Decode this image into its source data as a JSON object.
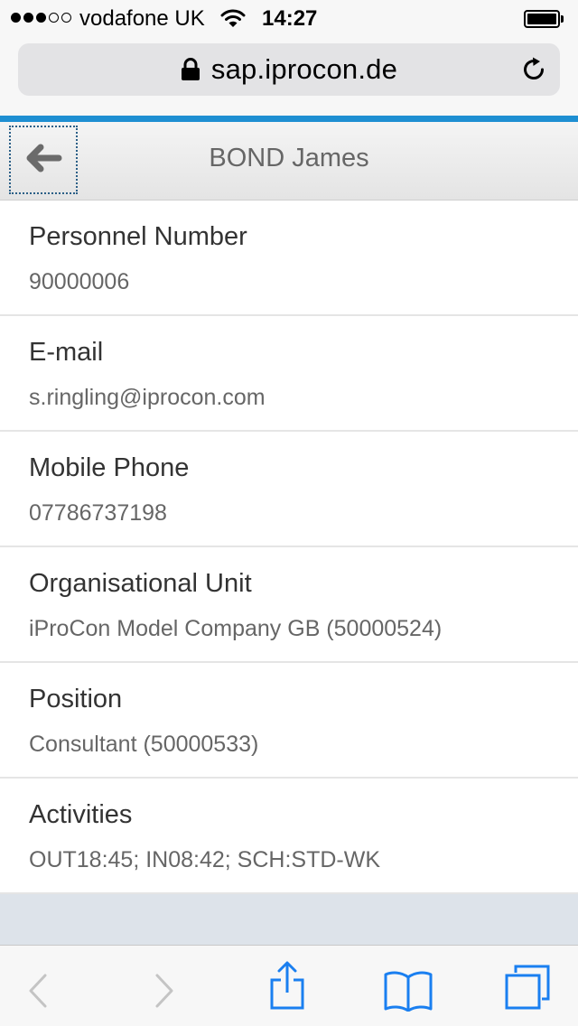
{
  "status_bar": {
    "signal_bars_filled": 3,
    "signal_bars_total": 5,
    "carrier": "vodafone UK",
    "time": "14:27",
    "battery_level": 1.0
  },
  "browser": {
    "url": "sap.iprocon.de",
    "icons": {
      "lock": "lock-icon",
      "reload": "reload-icon",
      "back": "chevron-left-icon",
      "forward": "chevron-right-icon",
      "share": "share-icon",
      "bookmarks": "book-icon",
      "tabs": "tabs-icon"
    },
    "accent_color": "#1e8fd2"
  },
  "header": {
    "title": "BOND James",
    "back_icon": "arrow-left-icon"
  },
  "fields": [
    {
      "label": "Personnel Number",
      "value": "90000006"
    },
    {
      "label": "E-mail",
      "value": "s.ringling@iprocon.com"
    },
    {
      "label": "Mobile Phone",
      "value": "07786737198"
    },
    {
      "label": "Organisational Unit",
      "value": "iProCon Model Company GB (50000524)"
    },
    {
      "label": "Position",
      "value": "Consultant (50000533)"
    },
    {
      "label": "Activities",
      "value": "OUT18:45; IN08:42; SCH:STD-WK"
    }
  ]
}
